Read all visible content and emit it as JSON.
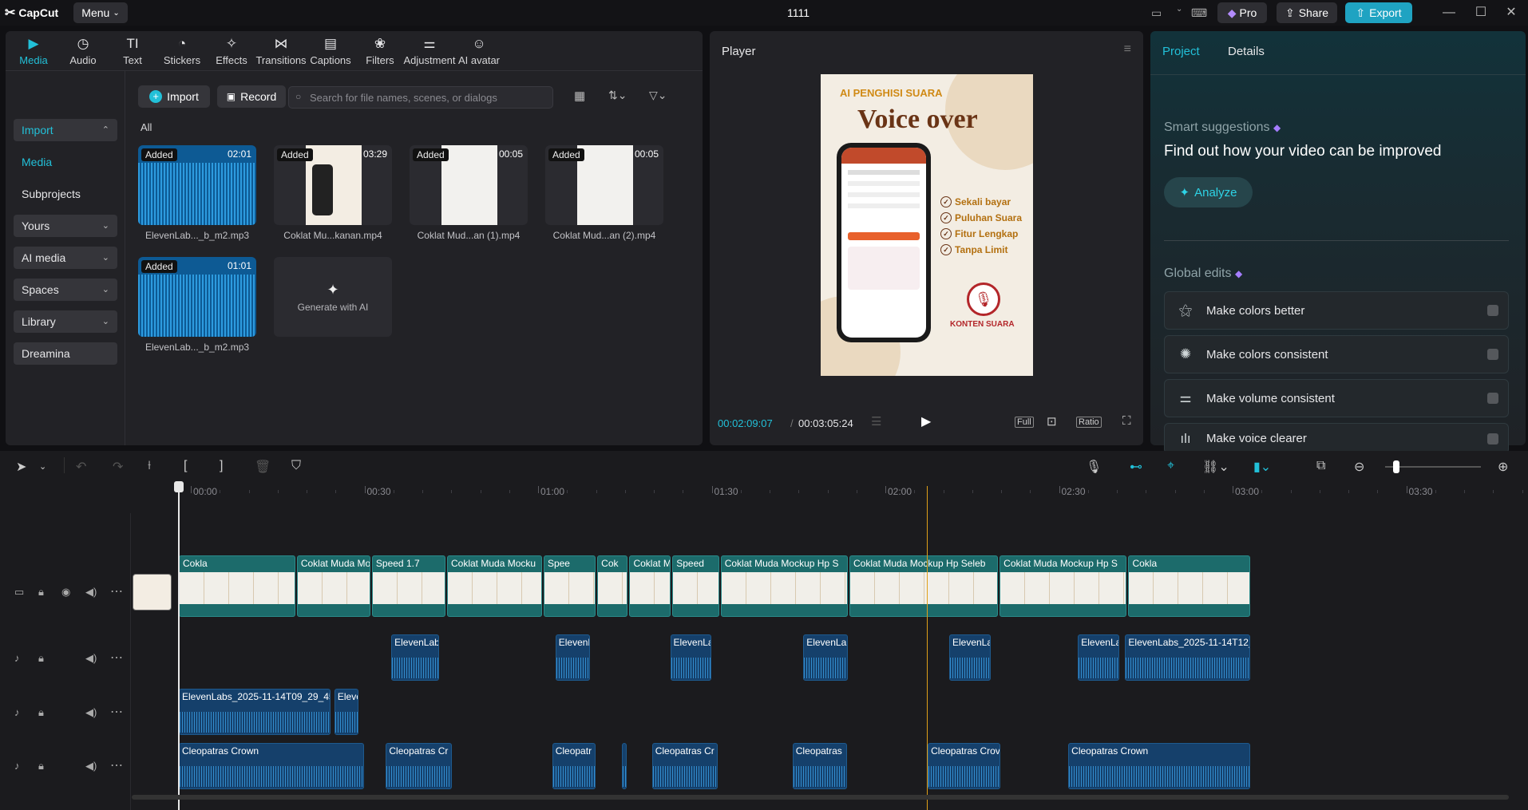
{
  "app": {
    "brand": "CapCut",
    "menu_label": "Menu",
    "project_title": "1111"
  },
  "topbar": {
    "pro_label": "Pro",
    "share_label": "Share",
    "export_label": "Export"
  },
  "toolbar": [
    {
      "label": "Media",
      "icon": "media-icon",
      "active": true
    },
    {
      "label": "Audio",
      "icon": "audio-icon"
    },
    {
      "label": "Text",
      "icon": "text-icon"
    },
    {
      "label": "Stickers",
      "icon": "stickers-icon"
    },
    {
      "label": "Effects",
      "icon": "effects-icon"
    },
    {
      "label": "Transitions",
      "icon": "transitions-icon"
    },
    {
      "label": "Captions",
      "icon": "captions-icon"
    },
    {
      "label": "Filters",
      "icon": "filters-icon"
    },
    {
      "label": "Adjustment",
      "icon": "adjustment-icon"
    },
    {
      "label": "AI avatar",
      "icon": "ai-avatar-icon"
    }
  ],
  "sidebar": [
    {
      "label": "Import",
      "boxed": true,
      "accent": true,
      "chevron": "up"
    },
    {
      "label": "Media",
      "accent": true
    },
    {
      "label": "Subprojects"
    },
    {
      "label": "Yours",
      "boxed": true,
      "chevron": "down"
    },
    {
      "label": "AI media",
      "boxed": true,
      "chevron": "down"
    },
    {
      "label": "Spaces",
      "boxed": true,
      "chevron": "down"
    },
    {
      "label": "Library",
      "boxed": true,
      "chevron": "down"
    },
    {
      "label": "Dreamina",
      "boxed": true
    }
  ],
  "media_toolbar": {
    "import_label": "Import",
    "record_label": "Record",
    "search_placeholder": "Search for file names, scenes, or dialogs",
    "filter_label": "All"
  },
  "media_items": [
    {
      "badge": "Added",
      "duration": "02:01",
      "name": "ElevenLab..._b_m2.mp3",
      "kind": "audio"
    },
    {
      "badge": "Added",
      "duration": "03:29",
      "name": "Coklat Mu...kanan.mp4",
      "kind": "poster"
    },
    {
      "badge": "Added",
      "duration": "00:05",
      "name": "Coklat Mud...an (1).mp4",
      "kind": "blank"
    },
    {
      "badge": "Added",
      "duration": "00:05",
      "name": "Coklat Mud...an (2).mp4",
      "kind": "blank"
    },
    {
      "badge": "Added",
      "duration": "01:01",
      "name": "ElevenLab..._b_m2.mp3",
      "kind": "audio"
    }
  ],
  "generate_ai_label": "Generate with AI",
  "player": {
    "title": "Player",
    "current_time": "00:02:09:07",
    "total_time": "00:03:05:24",
    "full_label": "Full",
    "ratio_label": "Ratio",
    "preview": {
      "headline": "AI PENGHISI SUARA",
      "title": "Voice over",
      "checks": [
        "Sekali bayar",
        "Puluhan Suara",
        "Fitur Lengkap",
        "Tanpa Limit"
      ],
      "brand": "KONTEN SUARA"
    }
  },
  "properties": {
    "tab_project": "Project",
    "tab_details": "Details",
    "smart_label": "Smart suggestions",
    "smart_heading": "Find out how your video can be improved",
    "analyze_label": "Analyze",
    "global_label": "Global edits",
    "edits": [
      {
        "label": "Make colors better",
        "icon": "magic-wand-icon"
      },
      {
        "label": "Make colors consistent",
        "icon": "palette-icon"
      },
      {
        "label": "Make volume consistent",
        "icon": "sliders-icon"
      },
      {
        "label": "Make voice clearer",
        "icon": "voice-icon"
      }
    ]
  },
  "ruler": [
    "00:00",
    "00:30",
    "01:00",
    "01:30",
    "02:00",
    "02:30",
    "03:00",
    "03:30"
  ],
  "tracks": {
    "video": [
      {
        "label": "Cokla",
        "start": 0,
        "end": 0.11
      },
      {
        "label": "Coklat Muda Mo",
        "start": 0.11,
        "end": 0.18
      },
      {
        "label": "Speed 1.7",
        "start": 0.18,
        "end": 0.25
      },
      {
        "label": "Coklat Muda Mocku",
        "start": 0.25,
        "end": 0.34
      },
      {
        "label": "Spee",
        "start": 0.34,
        "end": 0.39
      },
      {
        "label": "Cok",
        "start": 0.39,
        "end": 0.42
      },
      {
        "label": "Coklat M",
        "start": 0.42,
        "end": 0.46
      },
      {
        "label": "Speed",
        "start": 0.46,
        "end": 0.505
      },
      {
        "label": "Coklat Muda Mockup Hp S",
        "start": 0.505,
        "end": 0.625
      },
      {
        "label": "Coklat Muda Mockup Hp Seleb",
        "start": 0.625,
        "end": 0.765
      },
      {
        "label": "Coklat Muda Mockup Hp S",
        "start": 0.765,
        "end": 0.885
      },
      {
        "label": "Cokla",
        "start": 0.885,
        "end": 1.0
      }
    ],
    "audio1": [
      {
        "label": "ElevenLab",
        "start": 0.198,
        "end": 0.244
      },
      {
        "label": "ElevenL",
        "start": 0.351,
        "end": 0.385
      },
      {
        "label": "ElevenLa",
        "start": 0.458,
        "end": 0.498
      },
      {
        "label": "ElevenLab",
        "start": 0.582,
        "end": 0.625
      },
      {
        "label": "ElevenLa",
        "start": 0.718,
        "end": 0.758
      },
      {
        "label": "ElevenLa",
        "start": 0.838,
        "end": 0.878
      },
      {
        "label": "ElevenLabs_2025-11-14T12_",
        "start": 0.882,
        "end": 1.0
      }
    ],
    "audio2": [
      {
        "label": "ElevenLabs_2025-11-14T09_29_45",
        "start": 0.0,
        "end": 0.143
      },
      {
        "label": "Eleve",
        "start": 0.145,
        "end": 0.169
      }
    ],
    "music": [
      {
        "label": "Cleopatras Crown",
        "start": 0.0,
        "end": 0.174
      },
      {
        "label": "Cleopatras Cr",
        "start": 0.193,
        "end": 0.256
      },
      {
        "label": "Cleopatr",
        "start": 0.348,
        "end": 0.39
      },
      {
        "label": "",
        "start": 0.413,
        "end": 0.419
      },
      {
        "label": "Cleopatras Cr",
        "start": 0.441,
        "end": 0.504
      },
      {
        "label": "Cleopatras",
        "start": 0.572,
        "end": 0.624
      },
      {
        "label": "Cleopatras Crov",
        "start": 0.698,
        "end": 0.767
      },
      {
        "label": "Cleopatras Crown",
        "start": 0.829,
        "end": 1.0
      }
    ]
  },
  "playhead_fraction": 0.697,
  "zoom_level": 0.12
}
